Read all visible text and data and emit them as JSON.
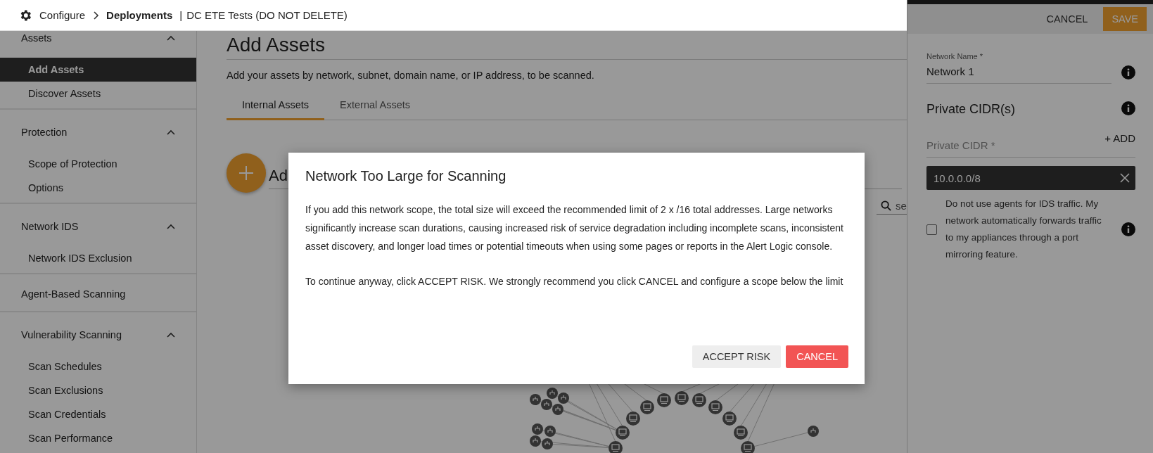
{
  "breadcrumb": {
    "section": "Configure",
    "page": "Deployments",
    "separator": "|",
    "deployment": "DC ETE Tests (DO NOT DELETE)"
  },
  "sidebar": {
    "groups": [
      {
        "label": "Assets",
        "kind": "section",
        "expanded": true,
        "items": [
          {
            "label": "Add Assets",
            "selected": true
          },
          {
            "label": "Discover Assets",
            "selected": false
          }
        ]
      },
      {
        "label": "Protection",
        "kind": "section",
        "expanded": true,
        "items": [
          {
            "label": "Scope of Protection",
            "selected": false
          },
          {
            "label": "Options",
            "selected": false
          }
        ]
      },
      {
        "label": "Network IDS",
        "kind": "section",
        "expanded": true,
        "items": [
          {
            "label": "Network IDS Exclusion",
            "selected": false
          }
        ]
      },
      {
        "label": "Agent-Based Scanning",
        "kind": "link"
      },
      {
        "label": "Vulnerability Scanning",
        "kind": "section",
        "expanded": true,
        "items": [
          {
            "label": "Scan Schedules",
            "selected": false
          },
          {
            "label": "Scan Exclusions",
            "selected": false
          },
          {
            "label": "Scan Credentials",
            "selected": false
          },
          {
            "label": "Scan Performance",
            "selected": false
          }
        ]
      }
    ]
  },
  "main": {
    "heading": "Add Assets",
    "description": "Add your assets by network, subnet, domain name, or IP address, to be scanned.",
    "tabs": [
      {
        "label": "Internal Assets",
        "selected": true
      },
      {
        "label": "External Assets",
        "selected": false
      }
    ],
    "add_label": "Ad",
    "search": {
      "placeholder": "se"
    }
  },
  "panel": {
    "cancel": "CANCEL",
    "save": "SAVE",
    "network_name": {
      "label": "Network Name *",
      "value": "Network 1"
    },
    "cidr_title": "Private CIDR(s)",
    "cidr_field": {
      "placeholder": "Private CIDR *"
    },
    "add": "+ ADD",
    "cidrs": [
      {
        "value": "10.0.0.0/8"
      }
    ],
    "ids_option": {
      "label": "Do not use agents for IDS traffic. My network automatically forwards traffic to my appliances through a port mirroring feature.",
      "checked": false
    }
  },
  "dialog": {
    "title": "Network Too Large for Scanning",
    "paragraphs": [
      "If you add this network scope, the total size will exceed the recommended limit of 2 x /16 total addresses. Large networks significantly increase scan durations, causing increased risk of service degradation including incomplete scans, inconsistent asset discovery, and longer load times or potential timeouts when using some pages or reports in the Alert Logic console.",
      "To continue anyway, click ACCEPT RISK. We strongly recommend you click CANCEL and configure a scope below the limit"
    ],
    "buttons": [
      {
        "label": "ACCEPT RISK",
        "kind": "secondary"
      },
      {
        "label": "CANCEL",
        "kind": "danger"
      }
    ]
  }
}
